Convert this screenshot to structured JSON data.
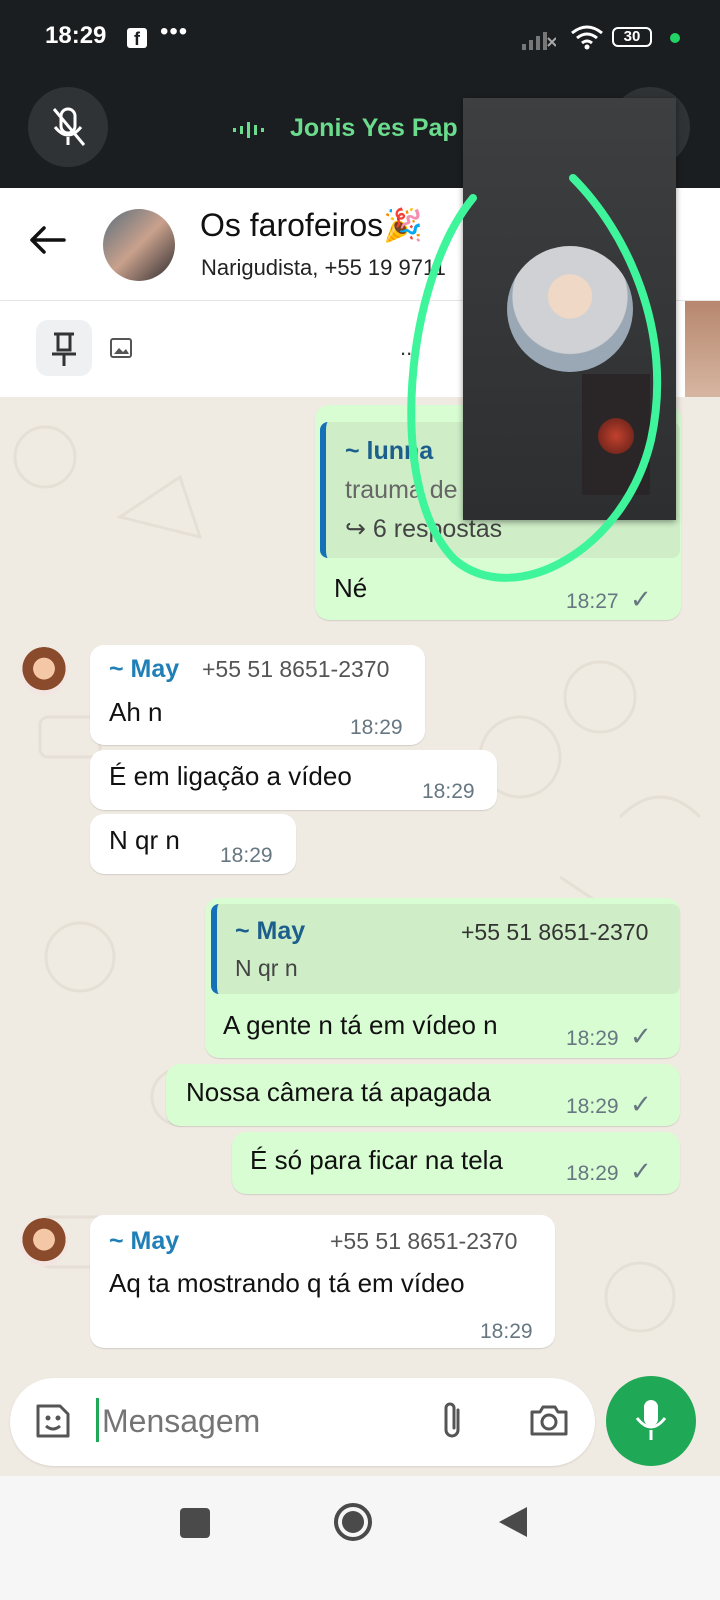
{
  "status_bar": {
    "time": "18:29",
    "dots": "•••",
    "battery": "30"
  },
  "call_bar": {
    "caller_name": "Jonis Yes Pap"
  },
  "chat_header": {
    "title": "Os farofeiros🎉",
    "subtitle": "Narigudista, +55 19 9711"
  },
  "pinned_bar": {
    "dots": ".."
  },
  "messages": {
    "m1": {
      "sender": "~ lunna",
      "quote_text": "trauma de",
      "replies": "6 respostas",
      "text": "Né",
      "time": "18:27"
    },
    "m2": {
      "sender": "~ May",
      "phone": "+55 51 8651-2370",
      "text": "Ah n",
      "time": "18:29"
    },
    "m3": {
      "text": "É em ligação a vídeo",
      "time": "18:29"
    },
    "m4": {
      "text": "N qr n",
      "time": "18:29"
    },
    "m5": {
      "quote_sender": "~ May",
      "quote_phone": "+55 51 8651-2370",
      "quote_text": "N qr n",
      "text": "A gente n tá em vídeo n",
      "time": "18:29"
    },
    "m6": {
      "text": "Nossa câmera tá apagada",
      "time": "18:29"
    },
    "m7": {
      "text": "É só para ficar na tela",
      "time": "18:29"
    },
    "m8": {
      "sender": "~ May",
      "phone": "+55 51 8651-2370",
      "text": "Aq ta mostrando q tá em vídeo",
      "time": "18:29"
    }
  },
  "composer": {
    "placeholder": "Mensagem"
  },
  "colors": {
    "accent": "#1fa855",
    "outgoing_bubble": "#d9fdd3",
    "call_name": "#6bdb8d",
    "annotation": "#3ff59b"
  }
}
